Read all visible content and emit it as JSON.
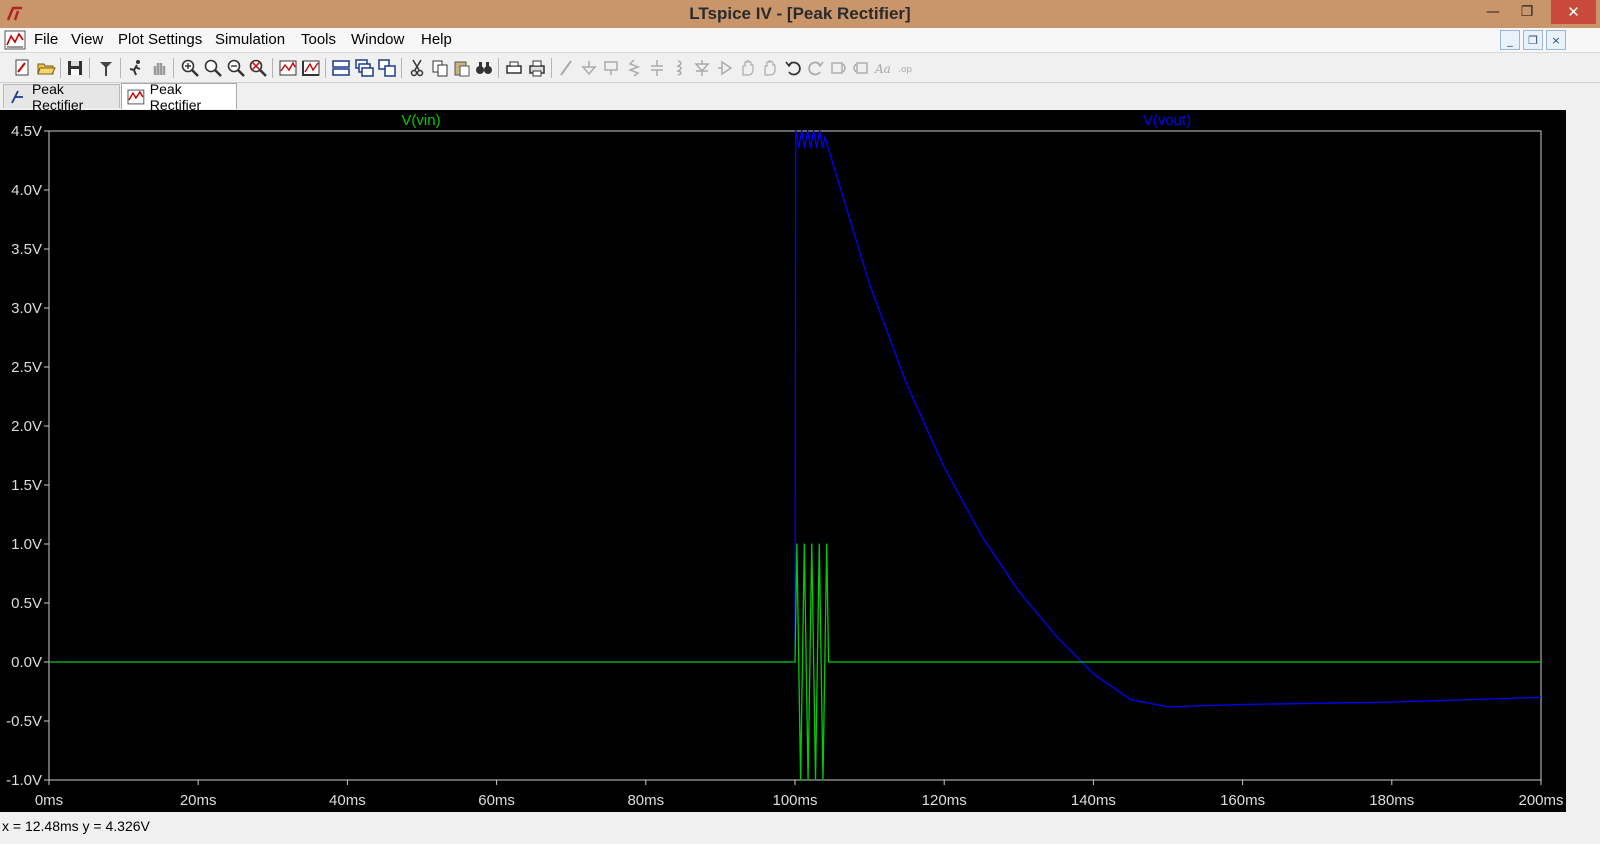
{
  "window": {
    "title": "LTspice IV - [Peak Rectifier]",
    "minimize_glyph": "—",
    "maximize_glyph": "❐",
    "close_glyph": "✕"
  },
  "menu": {
    "items": [
      {
        "label": "File"
      },
      {
        "label": "View"
      },
      {
        "label": "Plot Settings"
      },
      {
        "label": "Simulation"
      },
      {
        "label": "Tools"
      },
      {
        "label": "Window"
      },
      {
        "label": "Help"
      }
    ],
    "mdi_min": "_",
    "mdi_restore": "❐",
    "mdi_close": "×"
  },
  "toolbar": {
    "icons": [
      "new-schematic-icon",
      "open-icon",
      "save-icon",
      "control-panel-icon",
      "run-icon",
      "halt-icon",
      "zoom-in-icon",
      "zoom-area-icon",
      "zoom-out-icon",
      "zoom-fit-icon",
      "autorange-icon",
      "grid-icon",
      "tile-horizontal-icon",
      "cascade-icon",
      "tile-vertical-icon",
      "cut-icon",
      "copy-icon",
      "paste-icon",
      "find-icon",
      "print-preview-icon",
      "print-icon",
      "wire-icon",
      "ground-icon",
      "label-icon",
      "resistor-icon",
      "capacitor-icon",
      "inductor-icon",
      "diode-icon",
      "component-icon",
      "move-icon",
      "drag-icon",
      "undo-icon",
      "redo-icon",
      "rotate-icon",
      "mirror-icon",
      "text-icon",
      "spice-directive-icon"
    ]
  },
  "tabs": [
    {
      "label": "Peak Rectifier",
      "icon": "schematic-icon",
      "active": false
    },
    {
      "label": "Peak Rectifier",
      "icon": "waveform-icon",
      "active": true
    }
  ],
  "colors": {
    "background": "#000000",
    "vin": "#00cc00",
    "vout": "#0000ff",
    "axis": "#cccccc"
  },
  "chart_data": {
    "type": "line",
    "xlabel": "",
    "ylabel": "",
    "xlim": [
      0,
      200
    ],
    "ylim": [
      -1.0,
      4.5
    ],
    "x_ticks": [
      "0ms",
      "20ms",
      "40ms",
      "60ms",
      "80ms",
      "100ms",
      "120ms",
      "140ms",
      "160ms",
      "180ms",
      "200ms"
    ],
    "y_ticks": [
      "-1.0V",
      "-0.5V",
      "0.0V",
      "0.5V",
      "1.0V",
      "1.5V",
      "2.0V",
      "2.5V",
      "3.0V",
      "3.5V",
      "4.0V",
      "4.5V"
    ],
    "grid": false,
    "legend": "top",
    "series": [
      {
        "name": "V(vin)",
        "color": "#00cc00",
        "x": [
          0,
          100,
          100.25,
          100.5,
          100.75,
          101,
          101.25,
          101.5,
          101.75,
          102,
          102.25,
          102.5,
          102.75,
          103,
          103.25,
          103.5,
          103.75,
          104,
          104.25,
          104.5,
          200
        ],
        "y": [
          0,
          0,
          1,
          0,
          -1,
          0,
          1,
          0,
          -1,
          0,
          1,
          0,
          -1,
          0,
          1,
          0,
          -1,
          0,
          1,
          0,
          0
        ]
      },
      {
        "name": "V(vout)",
        "color": "#0000ff",
        "x": [
          0,
          100,
          100.1,
          100.5,
          100.9,
          101.3,
          101.7,
          102.1,
          102.5,
          102.9,
          103.3,
          103.7,
          104,
          110,
          115,
          120,
          125,
          130,
          135,
          140,
          145,
          150,
          155,
          160,
          170,
          180,
          190,
          200
        ],
        "y": [
          0,
          0,
          4.5,
          4.36,
          4.5,
          4.36,
          4.5,
          4.36,
          4.5,
          4.36,
          4.5,
          4.36,
          4.45,
          3.2,
          2.35,
          1.65,
          1.07,
          0.6,
          0.22,
          -0.1,
          -0.32,
          -0.38,
          -0.37,
          -0.36,
          -0.35,
          -0.34,
          -0.32,
          -0.3
        ]
      }
    ]
  },
  "status": {
    "cursor_readout": "x = 12.48ms    y = 4.326V"
  }
}
